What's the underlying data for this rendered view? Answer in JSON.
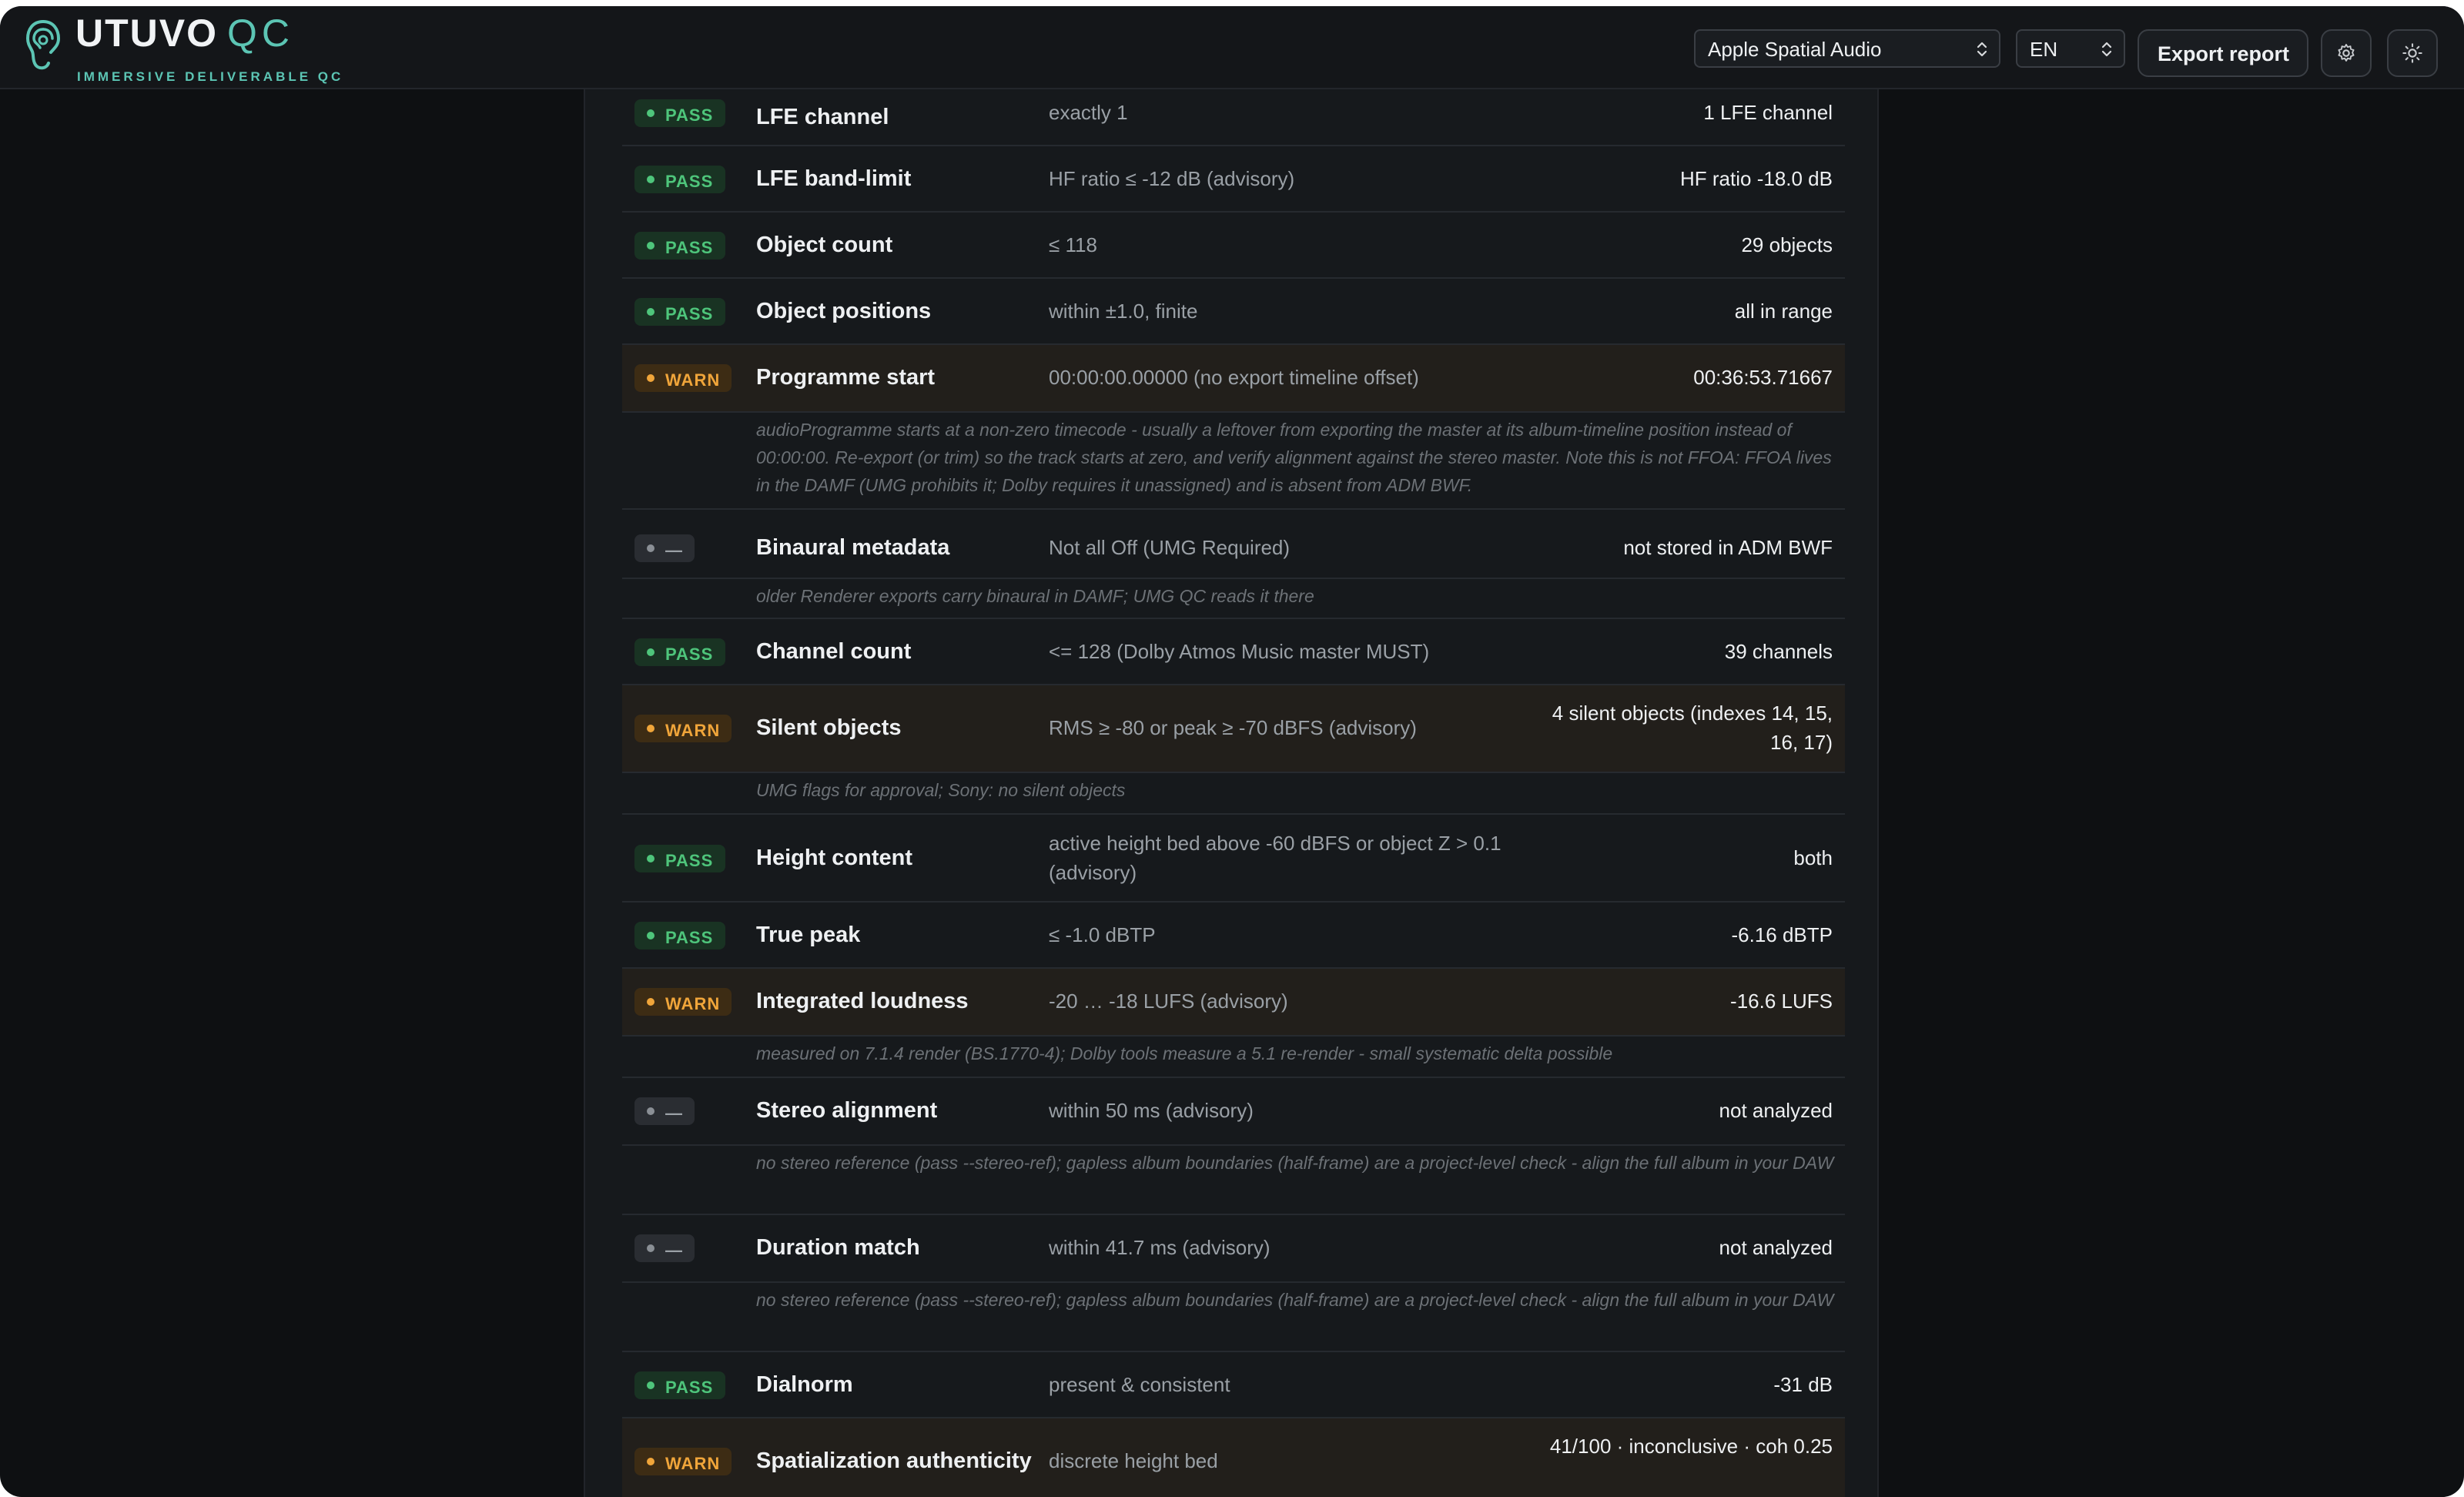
{
  "header": {
    "logo_name": "UTUVO",
    "logo_suffix": "QC",
    "tagline": "IMMERSIVE DELIVERABLE QC",
    "profile_select": "Apple Spatial Audio",
    "language_select": "EN",
    "export_label": "Export report",
    "settings_icon": "gear-icon",
    "theme_icon": "sun-icon"
  },
  "colors": {
    "accent": "#5cc5b4",
    "pass": "#4ec57b",
    "warn": "#f0a53a",
    "na": "#8a8f95",
    "background": "#0e1012",
    "panel": "#16191c"
  },
  "checks": [
    {
      "status": "pass",
      "badge": "PASS",
      "name": "LFE channel",
      "criterion": "exactly 1",
      "result": "1 LFE channel"
    },
    {
      "status": "pass",
      "badge": "PASS",
      "name": "LFE band-limit",
      "criterion": "HF ratio ≤ -12 dB (advisory)",
      "result": "HF ratio -18.0 dB"
    },
    {
      "status": "pass",
      "badge": "PASS",
      "name": "Object count",
      "criterion": "≤ 118",
      "result": "29 objects"
    },
    {
      "status": "pass",
      "badge": "PASS",
      "name": "Object positions",
      "criterion": "within ±1.0, finite",
      "result": "all in range"
    },
    {
      "status": "warn",
      "badge": "WARN",
      "name": "Programme start",
      "criterion": "00:00:00.00000 (no export timeline offset)",
      "result": "00:36:53.71667",
      "note": "audioProgramme starts at a non-zero timecode - usually a leftover from exporting the master at its album-timeline position instead of 00:00:00. Re-export (or trim) so the track starts at zero, and verify alignment against the stereo master. Note this is not FFOA: FFOA lives in the DAMF (UMG prohibits it; Dolby requires it unassigned) and is absent from ADM BWF."
    },
    {
      "status": "na",
      "badge": "—",
      "name": "Binaural metadata",
      "criterion": "Not all Off (UMG Required)",
      "result": "not stored in ADM BWF",
      "note": "older Renderer exports carry binaural in DAMF; UMG QC reads it there"
    },
    {
      "status": "pass",
      "badge": "PASS",
      "name": "Channel count",
      "criterion": "<= 128 (Dolby Atmos Music master MUST)",
      "result": "39 channels"
    },
    {
      "status": "warn",
      "badge": "WARN",
      "name": "Silent objects",
      "criterion": "RMS ≥ -80 or peak ≥ -70 dBFS (advisory)",
      "result": "4 silent objects (indexes 14, 15, 16, 17)",
      "note": "UMG flags for approval; Sony: no silent objects"
    },
    {
      "status": "pass",
      "badge": "PASS",
      "name": "Height content",
      "criterion": "active height bed above -60 dBFS or object Z > 0.1 (advisory)",
      "result": "both"
    },
    {
      "status": "pass",
      "badge": "PASS",
      "name": "True peak",
      "criterion": "≤ -1.0 dBTP",
      "result": "-6.16 dBTP"
    },
    {
      "status": "warn",
      "badge": "WARN",
      "name": "Integrated loudness",
      "criterion": "-20 … -18 LUFS (advisory)",
      "result": "-16.6 LUFS",
      "note": "measured on 7.1.4 render (BS.1770-4); Dolby tools measure a 5.1 re-render - small systematic delta possible"
    },
    {
      "status": "na",
      "badge": "—",
      "name": "Stereo alignment",
      "criterion": "within 50 ms (advisory)",
      "result": "not analyzed",
      "note": "no stereo reference (pass --stereo-ref); gapless album boundaries (half-frame) are a project-level check - align the full album in your DAW"
    },
    {
      "status": "na",
      "badge": "—",
      "name": "Duration match",
      "criterion": "within 41.7 ms (advisory)",
      "result": "not analyzed",
      "note": "no stereo reference (pass --stereo-ref); gapless album boundaries (half-frame) are a project-level check - align the full album in your DAW"
    },
    {
      "status": "pass",
      "badge": "PASS",
      "name": "Dialnorm",
      "criterion": "present & consistent",
      "result": "-31 dB"
    },
    {
      "status": "warn",
      "badge": "WARN",
      "name": "Spatialization authenticity",
      "criterion": "discrete height bed",
      "result": "41/100 · inconclusive · coh 0.25"
    }
  ]
}
